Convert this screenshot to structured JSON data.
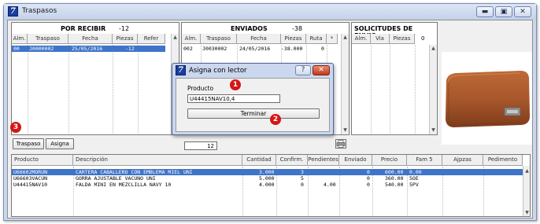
{
  "window": {
    "title": "Traspasos",
    "minimize": "▬",
    "restore": "▣",
    "close": "✕"
  },
  "por_recibir": {
    "title": "POR RECIBIR",
    "count": "-12",
    "columns": [
      "Alm.",
      "Traspaso",
      "Fecha",
      "Piezas",
      "Refer"
    ],
    "rows": [
      {
        "alm": "00",
        "traspaso": "J0000002",
        "fecha": "25/05/2016",
        "piezas": "-12",
        "refer": ""
      }
    ]
  },
  "enviados": {
    "title": "ENVIADOS",
    "count": "-38",
    "columns": [
      "Alm.",
      "Traspaso",
      "Fecha",
      "Piezas",
      "Ruta",
      "*"
    ],
    "rows": [
      {
        "alm": "002",
        "traspaso": "J0030002",
        "fecha": "24/05/2016",
        "piezas": "-38.000",
        "ruta": "0"
      }
    ]
  },
  "solicitudes": {
    "title": "SOLICITUDES DE ENVIO",
    "columns": [
      "Alm.",
      "Via",
      "Piezas"
    ],
    "count": "0"
  },
  "buttons": {
    "traspaso": "Traspaso",
    "asigna": "Asigna"
  },
  "total_field": "12",
  "detalle": {
    "columns": [
      "Producto",
      "Descripción",
      "Cantidad",
      "Confirm.",
      "Pendientes",
      "Enviado",
      "Precio",
      "Fam 5",
      "Ajpzas",
      "Pedimento"
    ],
    "rows": [
      {
        "producto": "U66602MORUN",
        "descripcion": "CARTERA CABALLERO CON EMBLEMA MIEL UNI",
        "cantidad": "3.000",
        "confirm": "3",
        "pendientes": "",
        "enviado": "0",
        "precio": "600.00",
        "fam5": "0.00"
      },
      {
        "producto": "U66603VACUN",
        "descripcion": "GORRA AJUSTABLE VACUNO UNI",
        "cantidad": "5.000",
        "confirm": "5",
        "pendientes": "",
        "enviado": "0",
        "precio": "360.00",
        "fam5": "5OE"
      },
      {
        "producto": "U44415NAV10",
        "descripcion": "FALDA MINI EN MEZCLILLA NAVY 10",
        "cantidad": "4.000",
        "confirm": "0",
        "pendientes": "4.00",
        "enviado": "0",
        "precio": "540.00",
        "fam5": "5PV"
      }
    ]
  },
  "dialog": {
    "title": "Asigna con lector",
    "help": "?",
    "close": "✕",
    "label": "Producto",
    "value": "U44415NAV10,4",
    "button": "Terminar"
  },
  "markers": {
    "m1": "1",
    "m2": "2",
    "m3": "3"
  },
  "colors": {
    "accent": "#3f74c8",
    "marker": "#d51616",
    "titlebar": "#cbd7ee",
    "wallet": "#a8572b"
  }
}
